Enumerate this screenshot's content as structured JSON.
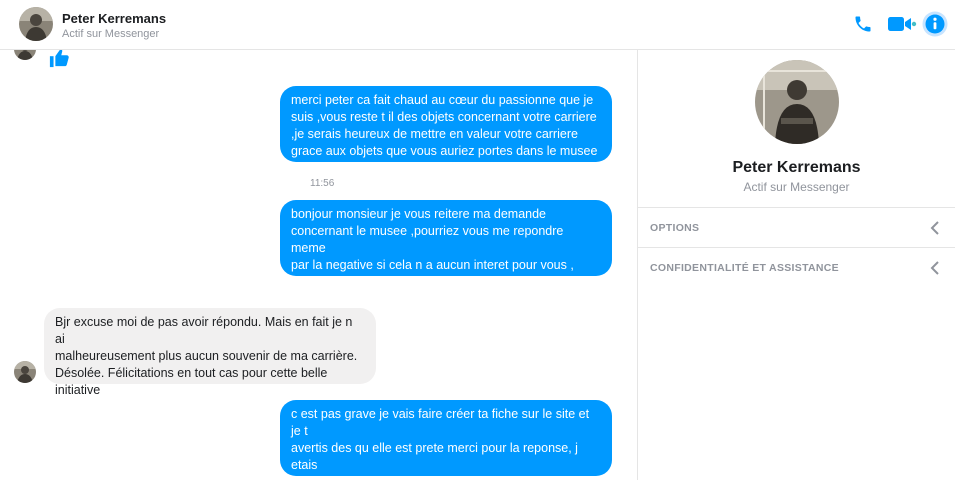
{
  "header": {
    "name": "Peter Kerremans",
    "status": "Actif sur Messenger",
    "icons": [
      "phone-icon",
      "video-camera-icon",
      "info-icon"
    ],
    "accent_color": "#0099ff"
  },
  "conversation": {
    "messages": [
      {
        "direction": "outgoing",
        "text": "merci peter  ca fait chaud au cœur du passionne que je\nsuis   ,vous reste t il des objets concernant votre carriere\n,je serais heureux de mettre en valeur votre carriere\ngrace aux objets que vous auriez portes dans le musee"
      },
      {
        "type": "timestamp",
        "text": "11:56"
      },
      {
        "direction": "outgoing",
        "text": "bonjour monsieur je vous reitere ma demande\nconcernant le musee ,pourriez vous me repondre meme\npar la negative si cela n a aucun interet pour vous , merci\npar avance sympathie christian"
      },
      {
        "direction": "incoming",
        "text": "Bjr excuse moi de pas avoir répondu. Mais en fait je n ai\nmalheureusement plus aucun souvenir de ma carrière.\nDésolée. Félicitations en tout cas pour  cette belle\ninitiative"
      },
      {
        "direction": "outgoing",
        "text": "c est pas grave je vais faire créer ta fiche sur le site et je t\navertis des qu elle est prete merci pour la reponse, j etais\netonne car tous les gardiens se sentent concernes a\nbientôt"
      }
    ],
    "reaction_icon": "thumbs-up-icon"
  },
  "sidebar": {
    "name": "Peter Kerremans",
    "status": "Actif sur Messenger",
    "options": [
      {
        "label": "OPTIONS"
      },
      {
        "label": "CONFIDENTIALITÉ ET ASSISTANCE"
      }
    ]
  }
}
